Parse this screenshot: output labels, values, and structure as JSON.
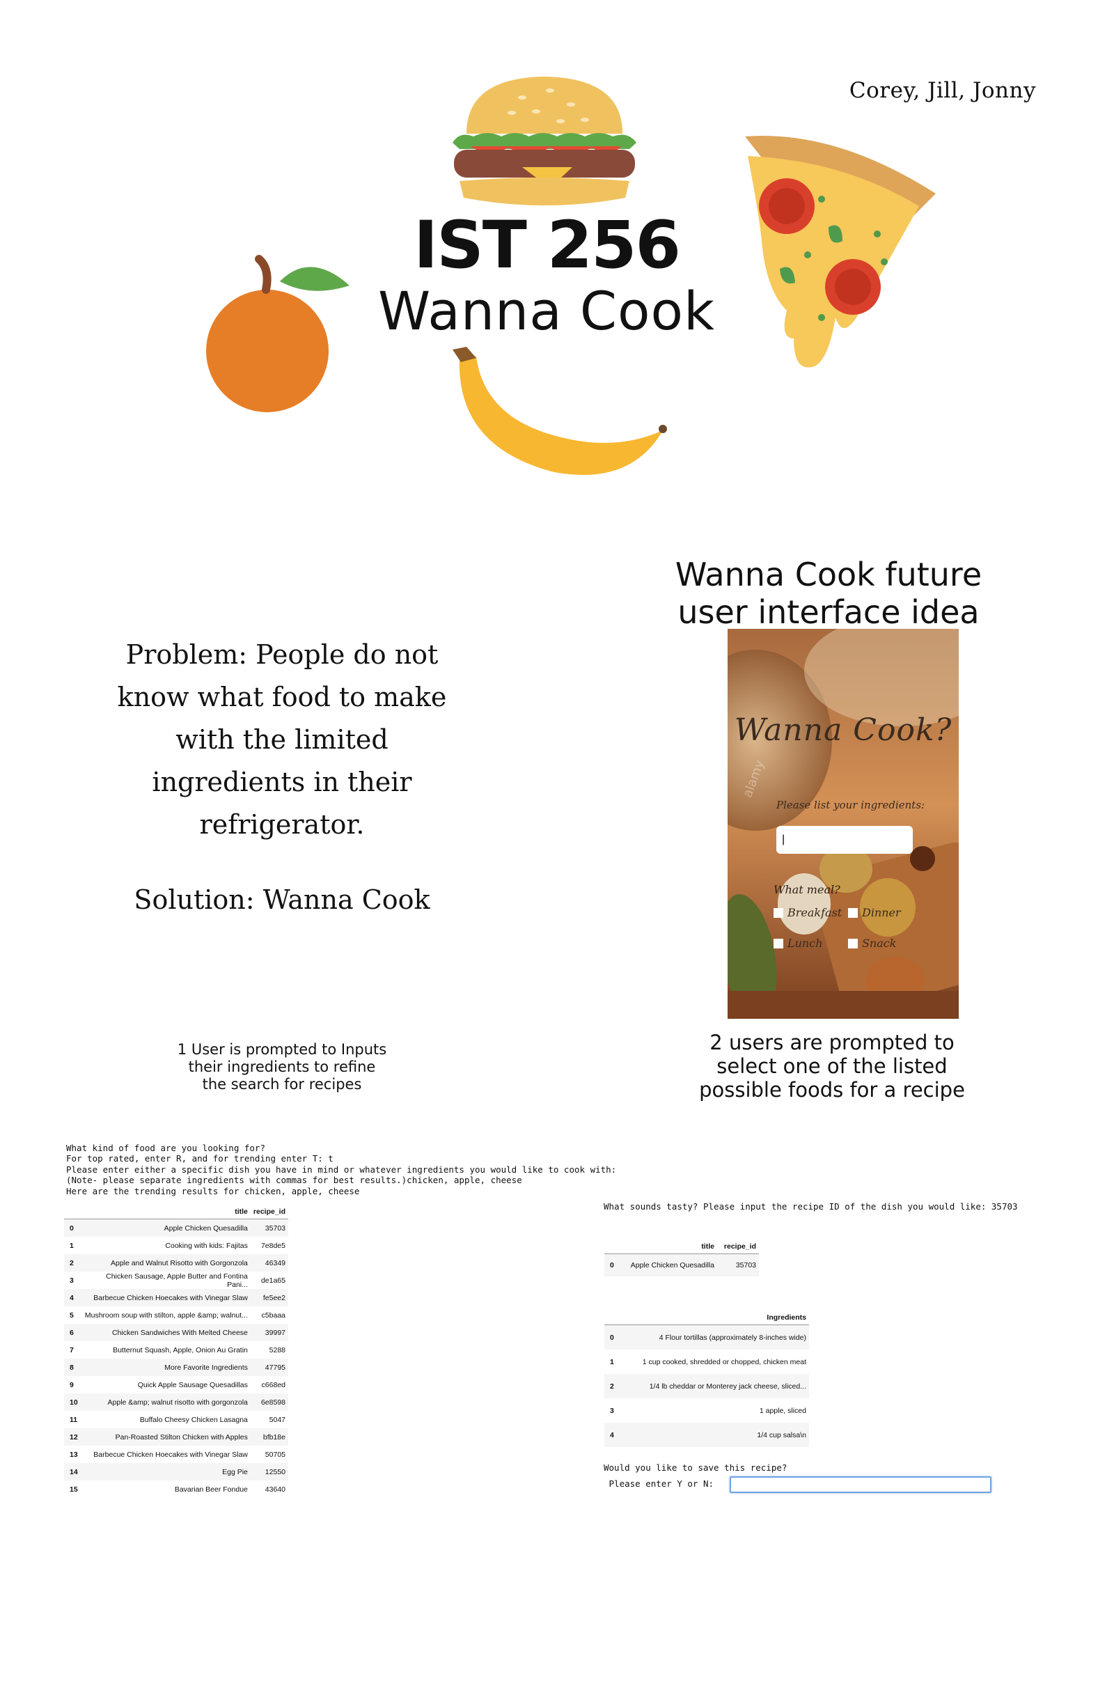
{
  "poster": {
    "authors": "Corey, Jill, Jonny",
    "course": "IST 256",
    "app_name": "Wanna Cook",
    "problem_lines": [
      "Problem: People do not",
      "know what food to make",
      "with the limited",
      "ingredients in their",
      "refrigerator."
    ],
    "solution": "Solution: Wanna Cook",
    "ui_idea_title_lines": [
      "Wanna Cook future",
      "user interface idea"
    ],
    "caption1_lines": [
      "1 User is prompted to  Inputs",
      "their ingredients to refine",
      "the search for recipes"
    ],
    "caption2_lines": [
      "2 users are prompted to",
      "select one of the listed",
      "possible foods for a recipe"
    ]
  },
  "mockup": {
    "title": "Wanna Cook?",
    "prompt": "Please list your ingredients:",
    "meal_label": "What meal?",
    "options": [
      "Breakfast",
      "Dinner",
      "Lunch",
      "Snack"
    ],
    "watermark": "alamy"
  },
  "console": {
    "lines": [
      "What kind of food are you looking for?",
      "For top rated, enter R, and for trending enter T: t",
      "Please enter either a specific dish you have in mind or whatever ingredients you would like to cook with:",
      "(Note- please separate ingredients with commas for best results.)chicken, apple, cheese",
      "Here are the trending results for chicken, apple, cheese"
    ],
    "results_table": {
      "columns": [
        "title",
        "recipe_id"
      ],
      "rows": [
        [
          "0",
          "Apple Chicken Quesadilla",
          "35703"
        ],
        [
          "1",
          "Cooking with kids: Fajitas",
          "7e8de5"
        ],
        [
          "2",
          "Apple and Walnut Risotto with Gorgonzola",
          "46349"
        ],
        [
          "3",
          "Chicken Sausage, Apple Butter and Fontina Pani...",
          "de1a65"
        ],
        [
          "4",
          "Barbecue Chicken Hoecakes with Vinegar Slaw",
          "fe5ee2"
        ],
        [
          "5",
          "Mushroom soup with stilton, apple &amp; walnut...",
          "c5baaa"
        ],
        [
          "6",
          "Chicken Sandwiches With Melted Cheese",
          "39997"
        ],
        [
          "7",
          "Butternut Squash, Apple, Onion Au Gratin",
          "5288"
        ],
        [
          "8",
          "More Favorite Ingredients",
          "47795"
        ],
        [
          "9",
          "Quick Apple Sausage Quesadillas",
          "c668ed"
        ],
        [
          "10",
          "Apple &amp; walnut risotto with gorgonzola",
          "6e8598"
        ],
        [
          "11",
          "Buffalo Cheesy Chicken Lasagna",
          "5047"
        ],
        [
          "12",
          "Pan-Roasted Stilton Chicken with Apples",
          "bfb18e"
        ],
        [
          "13",
          "Barbecue Chicken Hoecakes with Vinegar Slaw",
          "50705"
        ],
        [
          "14",
          "Egg Pie",
          "12550"
        ],
        [
          "15",
          "Bavarian Beer Fondue",
          "43640"
        ]
      ]
    },
    "pick_prompt": "What sounds tasty? Please input the recipe ID of the dish you would like: 35703",
    "chosen_table": {
      "columns": [
        "title",
        "recipe_id"
      ],
      "rows": [
        [
          "0",
          "Apple Chicken Quesadilla",
          "35703"
        ]
      ]
    },
    "ingredients_table": {
      "columns": [
        "Ingredients"
      ],
      "rows": [
        [
          "0",
          "4 Flour tortillas (approximately 8-inches wide)"
        ],
        [
          "1",
          "1 cup cooked, shredded or chopped, chicken meat"
        ],
        [
          "2",
          "1/4 lb cheddar or Monterey jack cheese, sliced..."
        ],
        [
          "3",
          "1 apple, sliced"
        ],
        [
          "4",
          "1/4 cup salsa\\n"
        ]
      ]
    },
    "save_prompt": "Would you like to save this recipe?",
    "save_input_label": " Please enter Y or N:",
    "save_input_value": ""
  }
}
